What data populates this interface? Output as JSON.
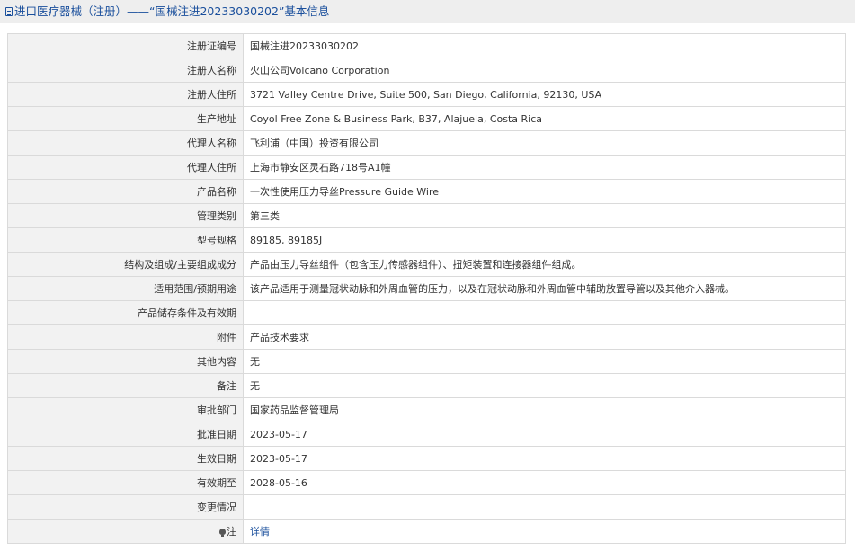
{
  "header": {
    "title": "进口医疗器械（注册）——“国械注进20233030202”基本信息"
  },
  "rows": [
    {
      "label": "注册证编号",
      "value": "国械注进20233030202"
    },
    {
      "label": "注册人名称",
      "value": "火山公司Volcano Corporation"
    },
    {
      "label": "注册人住所",
      "value": "3721 Valley Centre Drive, Suite 500, San Diego, California, 92130, USA"
    },
    {
      "label": "生产地址",
      "value": "Coyol Free Zone & Business Park, B37, Alajuela, Costa Rica"
    },
    {
      "label": "代理人名称",
      "value": "飞利浦（中国）投资有限公司"
    },
    {
      "label": "代理人住所",
      "value": "上海市静安区灵石路718号A1幢"
    },
    {
      "label": "产品名称",
      "value": "一次性使用压力导丝Pressure Guide Wire"
    },
    {
      "label": "管理类别",
      "value": "第三类"
    },
    {
      "label": "型号规格",
      "value": "89185, 89185J"
    },
    {
      "label": "结构及组成/主要组成成分",
      "value": "产品由压力导丝组件（包含压力传感器组件）、扭矩装置和连接器组件组成。"
    },
    {
      "label": "适用范围/预期用途",
      "value": "该产品适用于测量冠状动脉和外周血管的压力，以及在冠状动脉和外周血管中辅助放置导管以及其他介入器械。"
    },
    {
      "label": "产品储存条件及有效期",
      "value": ""
    },
    {
      "label": "附件",
      "value": "产品技术要求"
    },
    {
      "label": "其他内容",
      "value": "无"
    },
    {
      "label": "备注",
      "value": "无"
    },
    {
      "label": "审批部门",
      "value": "国家药品监督管理局"
    },
    {
      "label": "批准日期",
      "value": "2023-05-17"
    },
    {
      "label": "生效日期",
      "value": "2023-05-17"
    },
    {
      "label": "有效期至",
      "value": "2028-05-16"
    },
    {
      "label": "变更情况",
      "value": ""
    }
  ],
  "note": {
    "label": "注",
    "link_text": "详情"
  },
  "colors": {
    "header_bg": "#eeeeee",
    "title": "#1a4f9c",
    "label_bg": "#f2f2f2",
    "border": "#dadada",
    "link": "#1a4f9c"
  }
}
